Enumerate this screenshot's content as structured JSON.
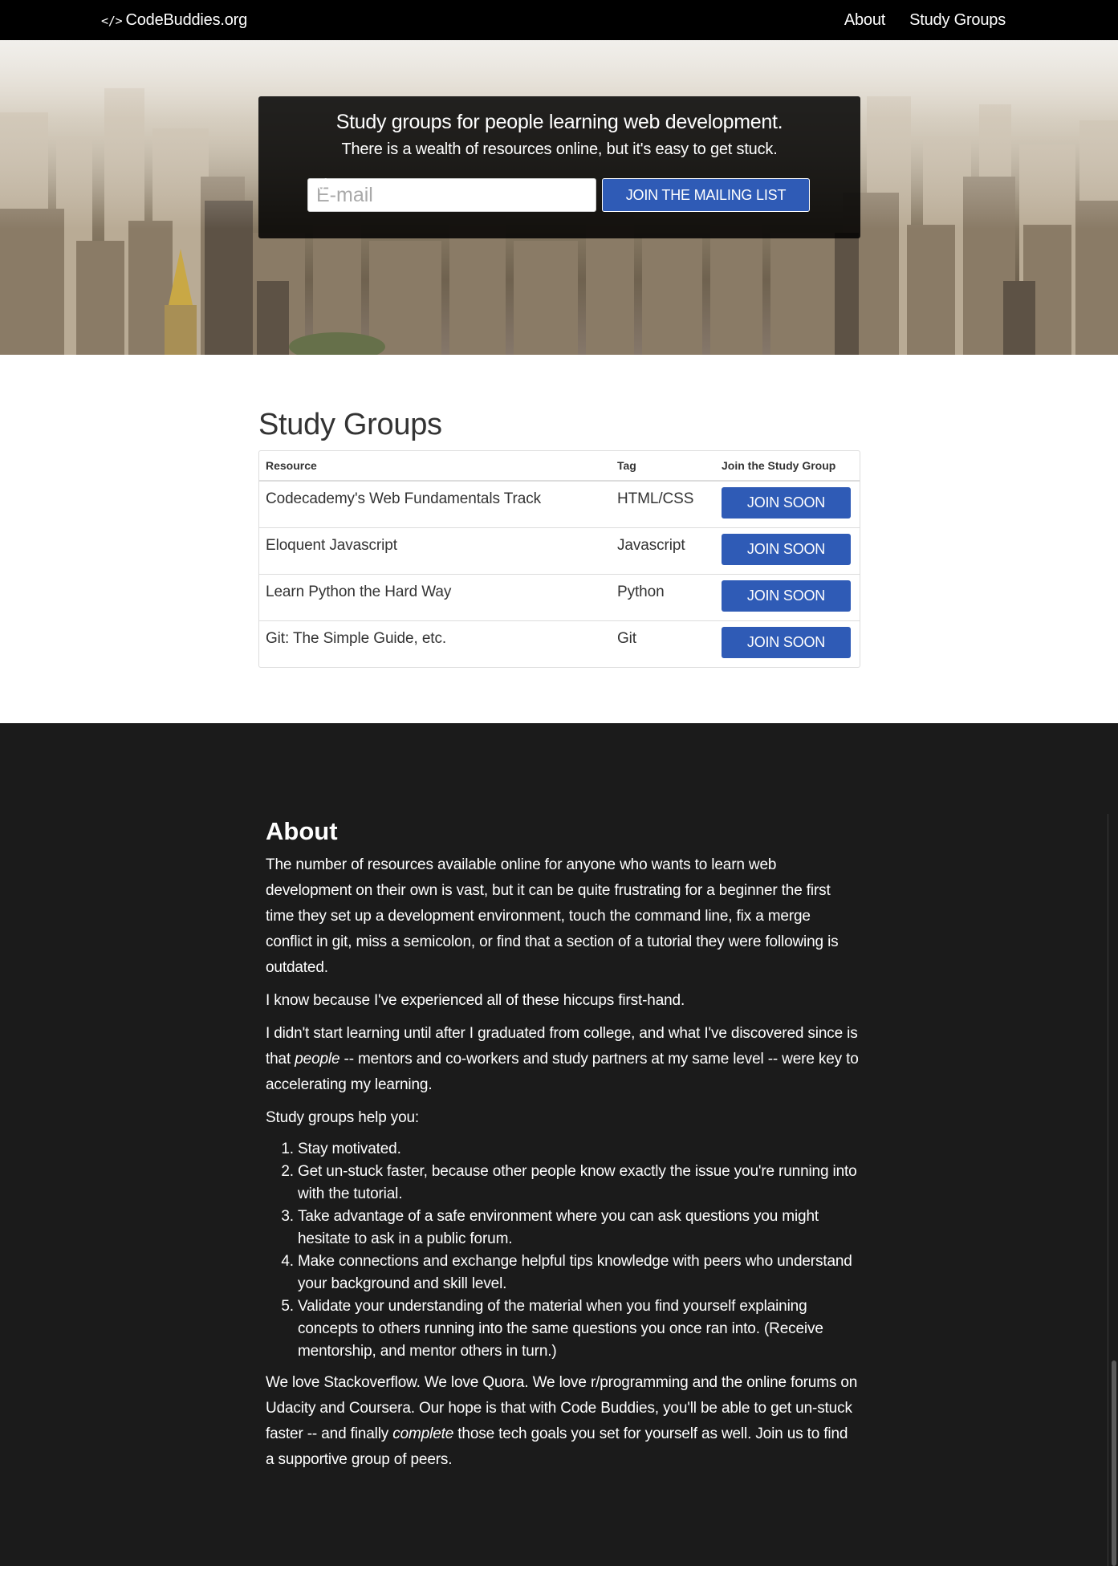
{
  "navbar": {
    "brand_icon": "</>",
    "brand_text": "CodeBuddies.org",
    "links": [
      "About",
      "Study Groups"
    ]
  },
  "hero": {
    "title": "Study groups for people learning web development.",
    "subtitle": "There is a wealth of resources online, but it's easy to get stuck.",
    "email_placeholder": "E-mail",
    "email_value": "",
    "mailing_button_label": "JOIN THE MAILING LIST",
    "mailing_button_icon": "paper-plane-icon",
    "background": "city-skyline-photo"
  },
  "study_groups": {
    "title": "Study Groups",
    "columns": [
      "Resource",
      "Tag",
      "Join the Study Group"
    ],
    "rows": [
      {
        "resource": "Codecademy's Web Fundamentals Track",
        "tag": "HTML/CSS",
        "button": "JOIN SOON"
      },
      {
        "resource": "Eloquent Javascript",
        "tag": "Javascript",
        "button": "JOIN SOON"
      },
      {
        "resource": "Learn Python the Hard Way",
        "tag": "Python",
        "button": "JOIN SOON"
      },
      {
        "resource": "Git: The Simple Guide, etc.",
        "tag": "Git",
        "button": "JOIN SOON"
      }
    ]
  },
  "about": {
    "title": "About",
    "p1": "The number of resources available online for anyone who wants to learn web development on their own is vast, but it can be quite frustrating for a beginner the first time they set up a development environment, touch the command line, fix a merge conflict in git, miss a semicolon, or find that a section of a tutorial they were following is outdated.",
    "p2": "I know because I've experienced all of these hiccups first-hand.",
    "p3_before": "I didn't start learning until after I graduated from college, and what I've discovered since is that ",
    "p3_em": "people",
    "p3_after": " -- mentors and co-workers and study partners at my same level -- were key to accelerating my learning.",
    "p4": "Study groups help you:",
    "list": [
      "Stay motivated.",
      "Get un-stuck faster, because other people know exactly the issue you're running into with the tutorial.",
      "Take advantage of a safe environment where you can ask questions you might hesitate to ask in a public forum.",
      "Make connections and exchange helpful tips knowledge with peers who understand your background and skill level.",
      "Validate your understanding of the material when you find yourself explaining concepts to others running into the same questions you once ran into. (Receive mentorship, and mentor others in turn.)"
    ],
    "p5_before": "We love Stackoverflow. We love Quora. We love r/programming and the online forums on Udacity and Coursera. Our hope is that with Code Buddies, you'll be able to get un-stuck faster -- and finally ",
    "p5_em": "complete",
    "p5_after": " those tech goals you set for yourself as well. Join us to find a supportive group of peers."
  },
  "colors": {
    "navbar_bg": "#000000",
    "accent_button": "#2f5bb6",
    "about_bg": "#1b1b1b",
    "hero_box_bg": "#000000d9"
  }
}
